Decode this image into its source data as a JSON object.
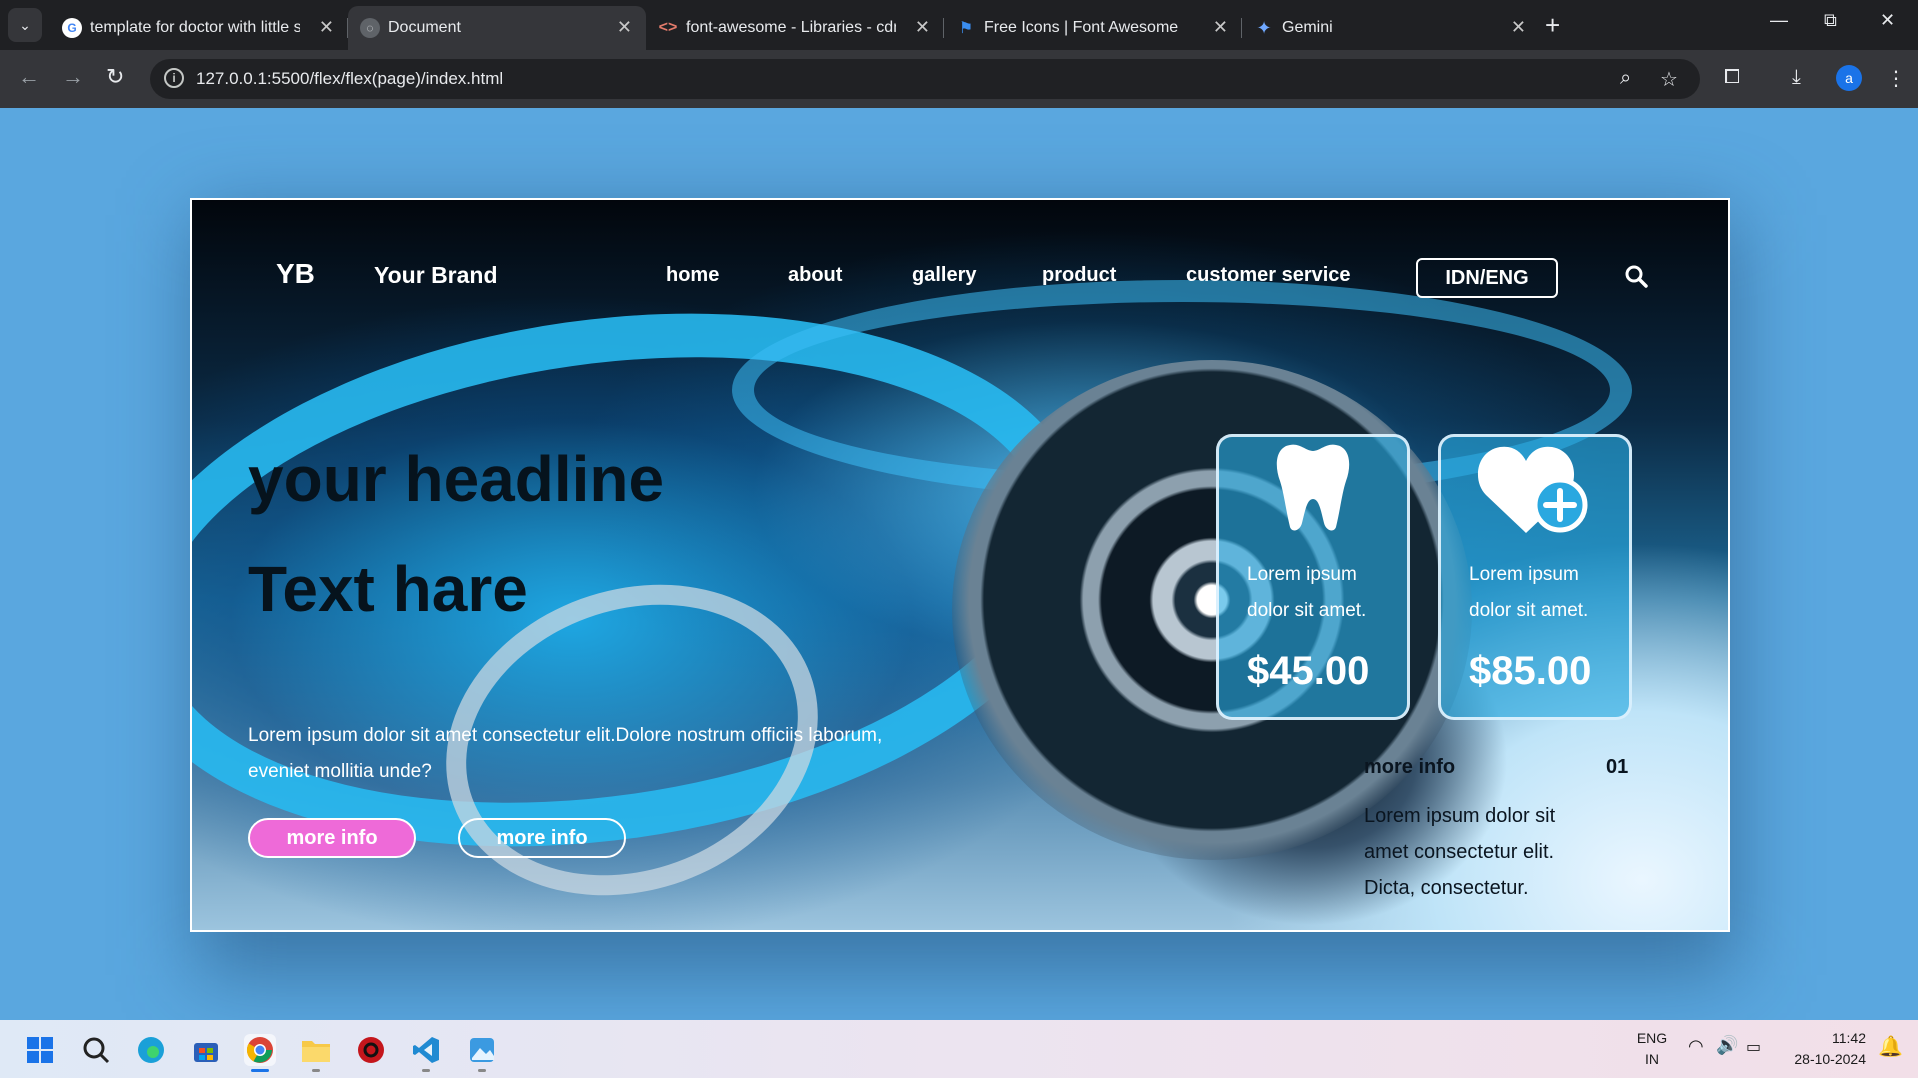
{
  "browser": {
    "tabs": [
      {
        "title": "template for doctor with little sl",
        "favicon": "google-icon",
        "active": false
      },
      {
        "title": "Document",
        "favicon": "globe-icon",
        "active": true
      },
      {
        "title": "font-awesome - Libraries - cdnj",
        "favicon": "code-icon",
        "active": false
      },
      {
        "title": "Free Icons | Font Awesome",
        "favicon": "flag-icon",
        "active": false
      },
      {
        "title": "Gemini",
        "favicon": "sparkle-icon",
        "active": false
      }
    ],
    "url": "127.0.0.1:5500/flex/flex(page)/index.html",
    "profile_initial": "a"
  },
  "site": {
    "logo": "YB",
    "brand": "Your Brand",
    "nav": [
      "home",
      "about",
      "gallery",
      "product",
      "customer service"
    ],
    "lang_button": "IDN/ENG",
    "headline": "your headline",
    "subhead": "Text hare",
    "body": "Lorem ipsum dolor sit amet consectetur elit.Dolore nostrum officiis laborum, eveniet mollitia unde?",
    "buttons": {
      "primary": "more info",
      "secondary": "more info"
    },
    "cards": [
      {
        "icon": "tooth-icon",
        "desc": "Lorem ipsum dolor sit amet.",
        "price": "$45.00"
      },
      {
        "icon": "heart-plus-icon",
        "desc": "Lorem ipsum dolor sit amet.",
        "price": "$85.00"
      }
    ],
    "info": {
      "title": "more info",
      "number": "01",
      "text": "Lorem ipsum dolor sit amet consectetur elit. Dicta, consectetur."
    }
  },
  "taskbar": {
    "apps": [
      "windows-start-icon",
      "search-icon",
      "edge-icon",
      "store-icon",
      "chrome-icon",
      "file-explorer-icon",
      "app-icon",
      "vscode-icon",
      "photos-icon"
    ],
    "lang_line1": "ENG",
    "lang_line2": "IN",
    "time": "11:42",
    "date": "28-10-2024"
  },
  "colors": {
    "page_bg": "#5aa7df",
    "accent_pink": "#ee6ad8",
    "card_bg": "#28aae1",
    "chrome_dark": "#1f2023"
  }
}
